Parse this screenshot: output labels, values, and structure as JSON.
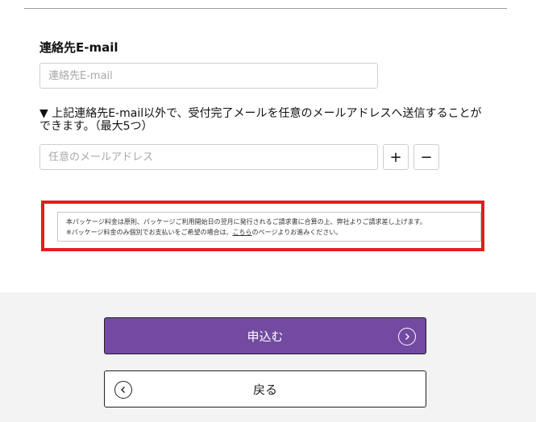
{
  "form": {
    "email_label": "連絡先E-mail",
    "email_placeholder": "連絡先E-mail",
    "email_value": "",
    "extra_note": "▼ 上記連絡先E-mail以外で、受付完了メールを任意のメールアドレスへ送信することができます。（最大5つ）",
    "extra_placeholder": "任意のメールアドレス",
    "extra_value": "",
    "add_label": "+",
    "remove_label": "−"
  },
  "notice": {
    "line1": "本パッケージ料金は原則、パッケージご利用開始日の翌月に発行されるご請求書に合算の上、弊社よりご請求差し上げます。",
    "line2_prefix": "※パッケージ料金のみ個別でお支払いをご希望の場合は、",
    "line2_link": "こちら",
    "line2_suffix": "のページよりお進みください。"
  },
  "actions": {
    "submit_label": "申込む",
    "back_label": "戻る"
  },
  "colors": {
    "accent": "#734aa1",
    "highlight_border": "#e01e1e"
  },
  "icons": {
    "submit": "chevron-right-circle-icon",
    "back": "chevron-left-circle-icon"
  }
}
